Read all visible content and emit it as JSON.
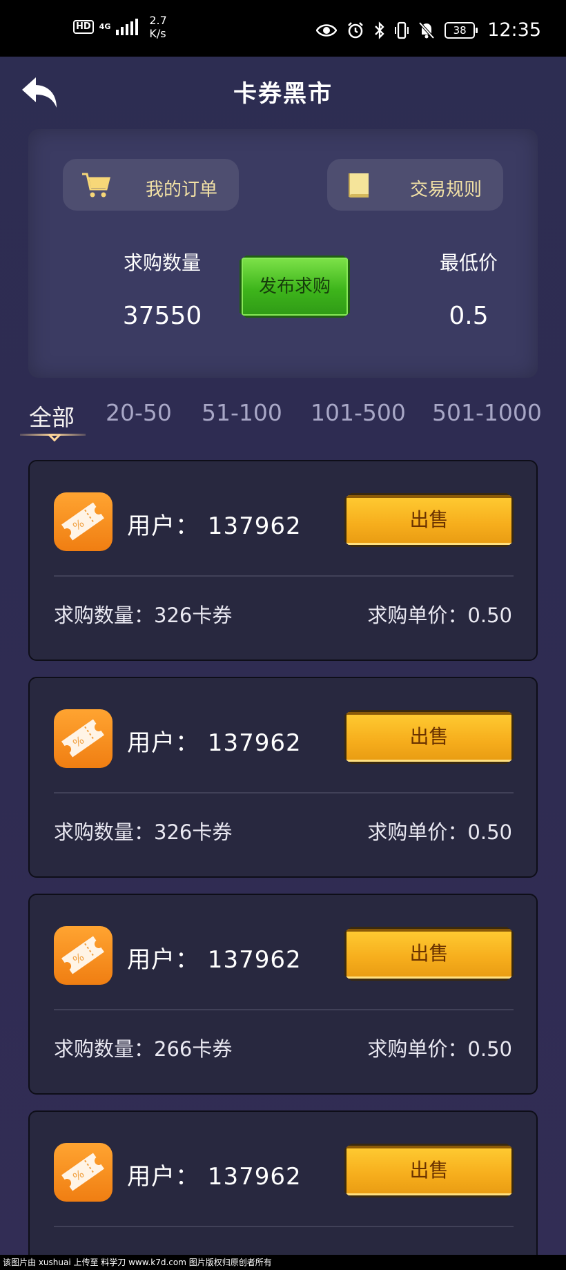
{
  "status_bar": {
    "hd": "HD",
    "network": "4G",
    "speed_value": "2.7",
    "speed_unit": "K/s",
    "battery": "38",
    "time": "12:35"
  },
  "header": {
    "title": "卡券黑市"
  },
  "summary": {
    "orders_label": "我的订单",
    "rules_label": "交易规则",
    "demand_label": "求购数量",
    "demand_value": "37550",
    "publish_label": "发布求购",
    "min_price_label": "最低价",
    "min_price_value": "0.5"
  },
  "tabs": [
    {
      "label": "全部"
    },
    {
      "label": "20-50"
    },
    {
      "label": "51-100"
    },
    {
      "label": "101-500"
    },
    {
      "label": "501-1000"
    }
  ],
  "listings": [
    {
      "user": "用户：  137962",
      "sell_label": "出售",
      "quantity": "求购数量：326卡券",
      "price": "求购单价：0.50"
    },
    {
      "user": "用户：  137962",
      "sell_label": "出售",
      "quantity": "求购数量：326卡券",
      "price": "求购单价：0.50"
    },
    {
      "user": "用户：  137962",
      "sell_label": "出售",
      "quantity": "求购数量：266卡券",
      "price": "求购单价：0.50"
    },
    {
      "user": "用户：  137962",
      "sell_label": "出售"
    }
  ],
  "watermark": "该图片由 xushuai 上传至 料学刀 www.k7d.com 图片版权归原创者所有",
  "colors": {
    "background": "#2d2d52",
    "panel": "#3b3b62",
    "card": "#28283f",
    "publish_green": "#3eb51b",
    "sell_gold": "#f6ad1c",
    "pill_text": "#f3e2a6"
  }
}
